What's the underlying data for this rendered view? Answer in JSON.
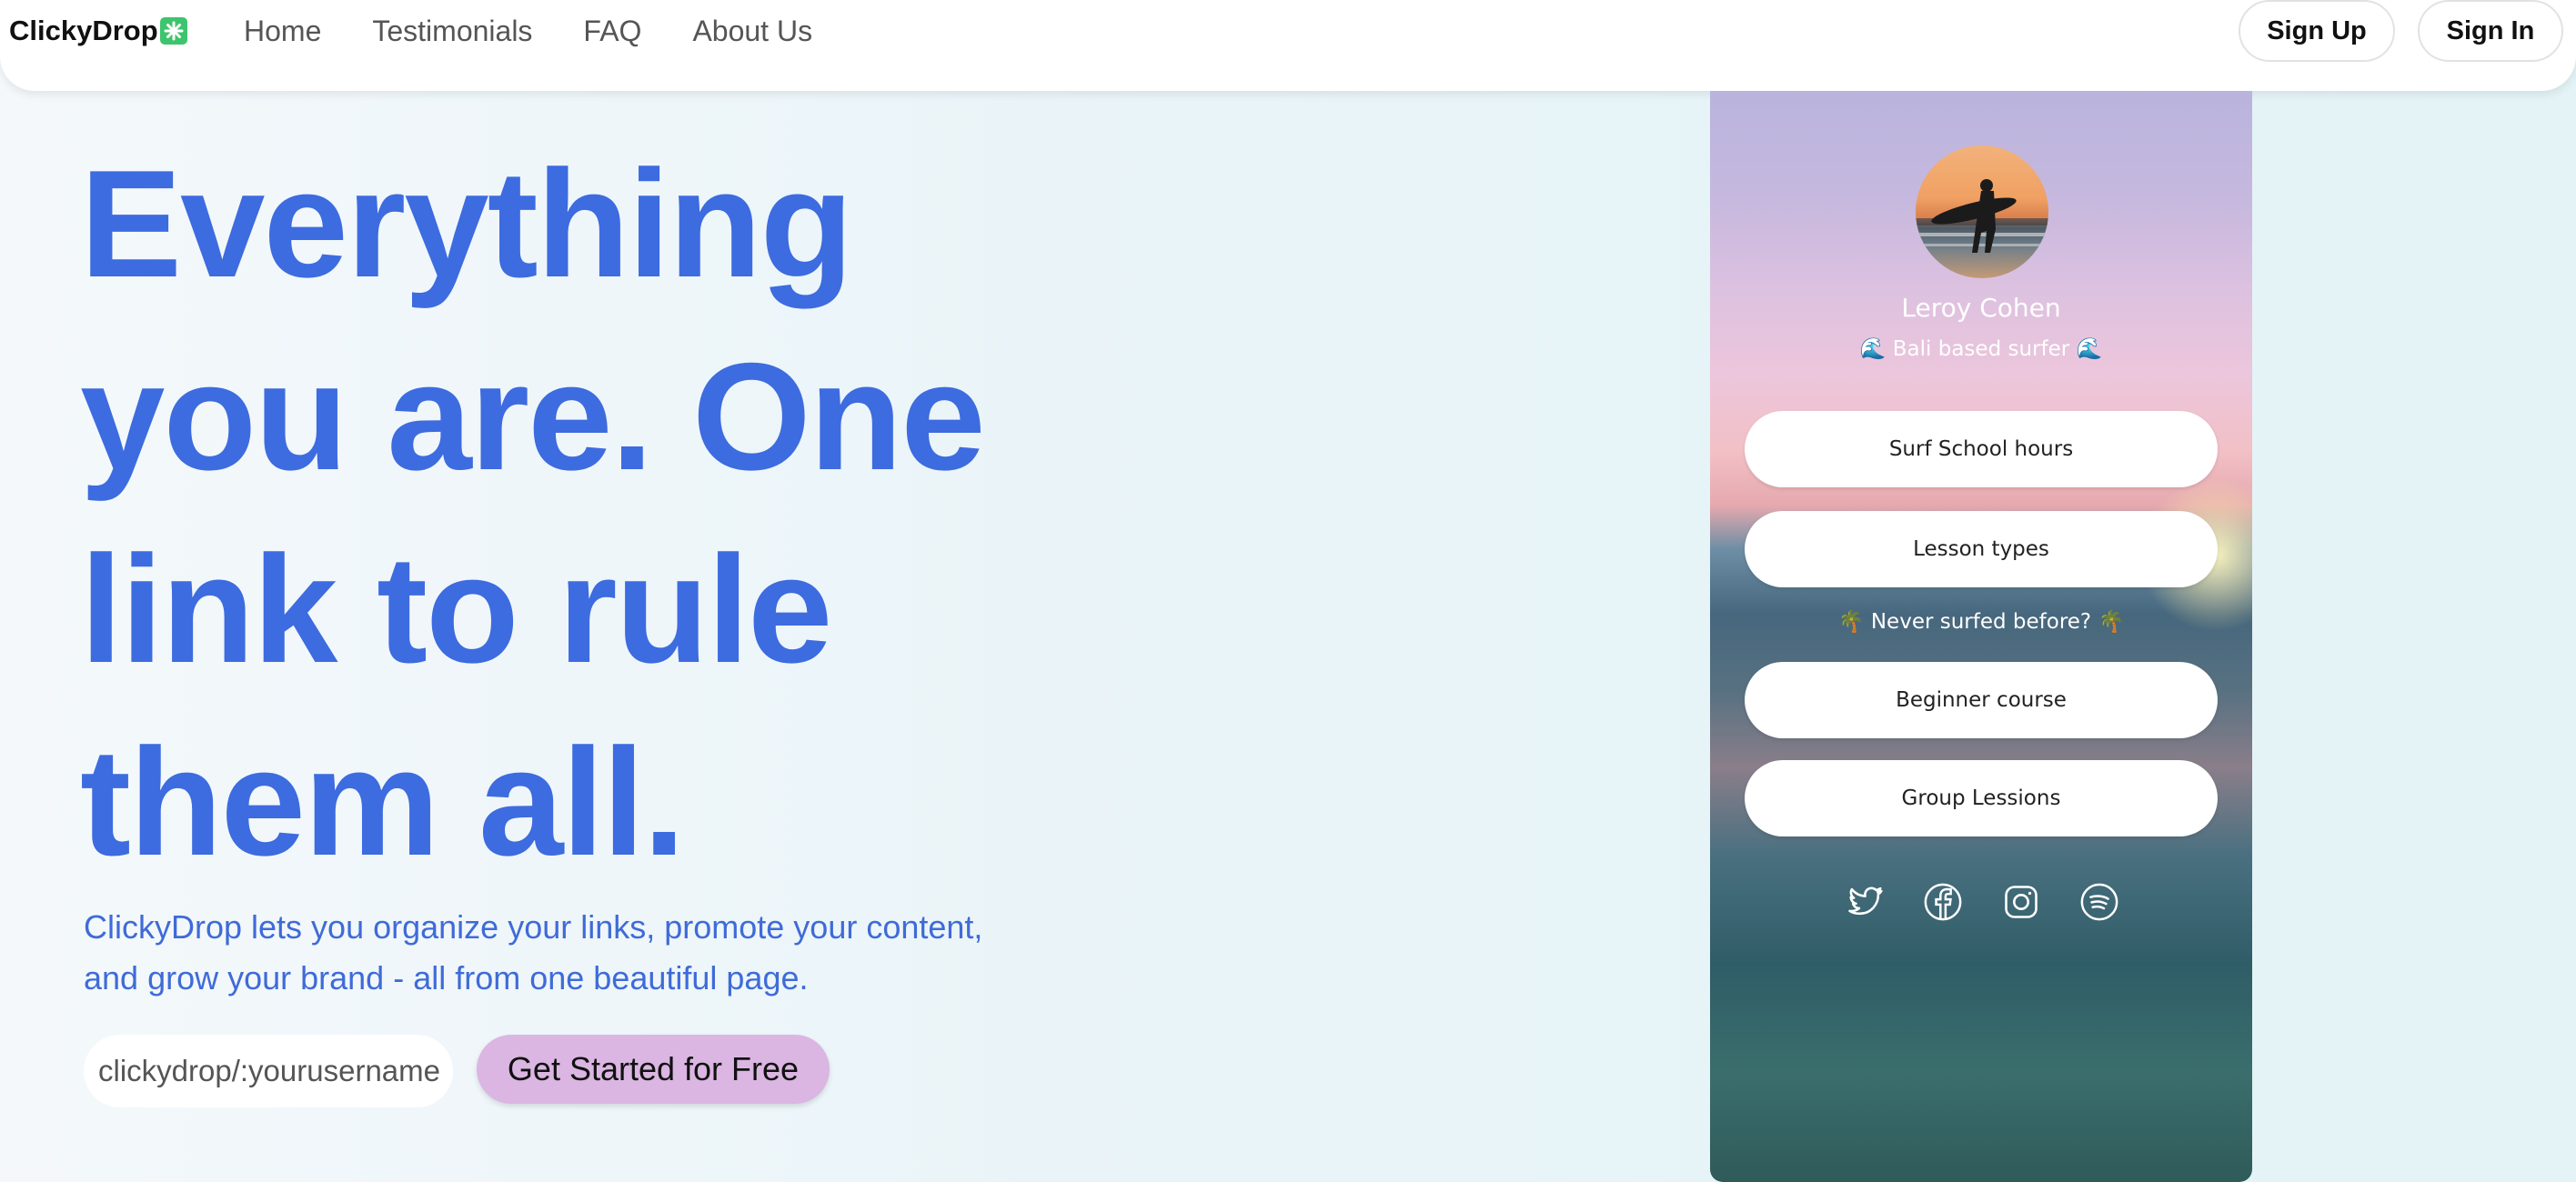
{
  "nav": {
    "brand": "ClickyDrop",
    "links": [
      {
        "label": "Home"
      },
      {
        "label": "Testimonials"
      },
      {
        "label": "FAQ"
      },
      {
        "label": "About Us"
      }
    ],
    "sign_up": "Sign Up",
    "sign_in": "Sign In"
  },
  "hero": {
    "title_lines": [
      "Everything",
      "you are. One",
      "link to rule",
      "them all."
    ],
    "subtitle_lines": [
      "ClickyDrop lets you organize your links, promote your content,",
      "and grow your brand - all from one beautiful page."
    ],
    "username_placeholder": "clickydrop/:yourusername",
    "cta": "Get Started for Free"
  },
  "preview": {
    "name": "Leroy Cohen",
    "bio": "🌊 Bali based surfer 🌊",
    "links": [
      {
        "label": "Surf School hours"
      },
      {
        "label": "Lesson types"
      },
      {
        "label": "Beginner course"
      },
      {
        "label": "Group Lessions"
      }
    ],
    "section_label": "🌴 Never surfed before? 🌴",
    "socials": [
      "twitter-icon",
      "facebook-icon",
      "instagram-icon",
      "spotify-icon"
    ]
  },
  "colors": {
    "accent": "#3d6be0",
    "cta_bg": "#dbb6e2",
    "logo_mark": "#3ec46d"
  }
}
